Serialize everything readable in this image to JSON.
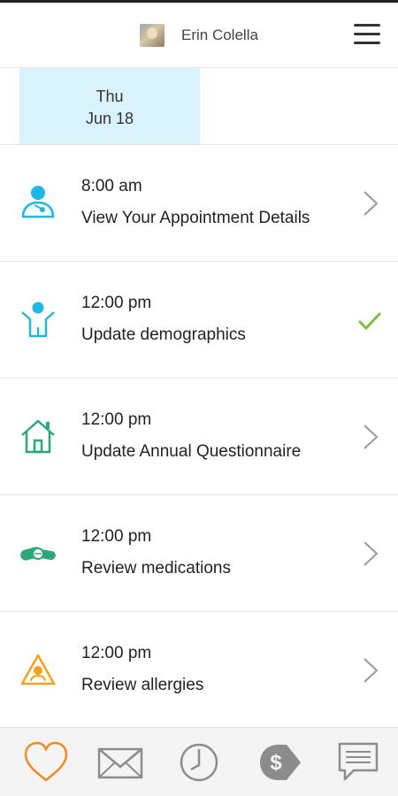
{
  "header": {
    "user_name": "Erin Colella"
  },
  "date": {
    "weekday": "Thu",
    "day": "Jun 18"
  },
  "tasks": [
    {
      "time": "8:00 am",
      "title": "View Your Appointment Details",
      "icon": "doctor-icon",
      "status": "chevron",
      "color": "#1fb8e6"
    },
    {
      "time": "12:00 pm",
      "title": "Update demographics",
      "icon": "person-icon",
      "status": "check",
      "color": "#1fb8e6"
    },
    {
      "time": "12:00 pm",
      "title": "Update Annual Questionnaire",
      "icon": "house-icon",
      "status": "chevron",
      "color": "#2aa87a"
    },
    {
      "time": "12:00 pm",
      "title": "Review medications",
      "icon": "pill-icon",
      "status": "chevron",
      "color": "#2aa87a"
    },
    {
      "time": "12:00 pm",
      "title": "Review allergies",
      "icon": "allergy-icon",
      "status": "chevron",
      "color": "#f0a21e"
    }
  ],
  "nav": [
    "heart-icon",
    "mail-icon",
    "clock-icon",
    "billing-icon",
    "chat-icon"
  ],
  "colors": {
    "accent_orange": "#f08a24",
    "date_highlight": "#d9f3fc",
    "check_green": "#7cbf3c",
    "nav_gray": "#8c8c8c"
  }
}
